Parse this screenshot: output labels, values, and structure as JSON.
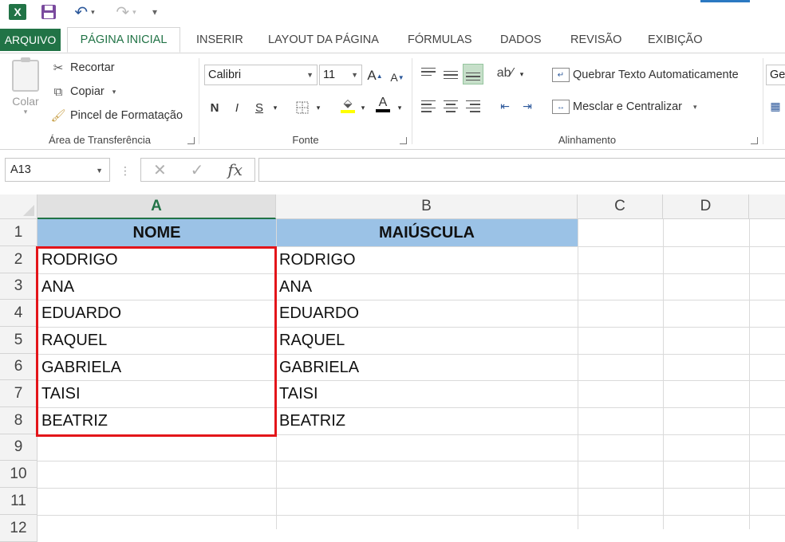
{
  "app": {
    "logo_text": "X"
  },
  "tabs": [
    "ARQUIVO",
    "PÁGINA INICIAL",
    "INSERIR",
    "LAYOUT DA PÁGINA",
    "FÓRMULAS",
    "DADOS",
    "REVISÃO",
    "EXIBIÇÃO"
  ],
  "active_tab": "PÁGINA INICIAL",
  "clipboard": {
    "paste_label": "Colar",
    "cut_label": "Recortar",
    "copy_label": "Copiar",
    "format_painter_label": "Pincel de Formatação",
    "group_label": "Área de Transferência"
  },
  "font": {
    "font_name": "Calibri",
    "font_size": "11",
    "bold": "N",
    "italic": "I",
    "underline": "S",
    "group_label": "Fonte"
  },
  "alignment": {
    "wrap_text_label": "Quebrar Texto Automaticamente",
    "merge_center_label": "Mesclar e Centralizar",
    "group_label": "Alinhamento"
  },
  "number": {
    "format_partial": "Ge"
  },
  "formula_bar": {
    "name_box": "A13",
    "fx_label": "fx",
    "formula": ""
  },
  "sheet": {
    "columns": [
      "A",
      "B",
      "C",
      "D"
    ],
    "rows": [
      "1",
      "2",
      "3",
      "4",
      "5",
      "6",
      "7",
      "8",
      "9",
      "10",
      "11",
      "12"
    ],
    "header": {
      "a": "NOME",
      "b": "MAIÚSCULA"
    },
    "names": [
      "RODRIGO",
      "ANA",
      "EDUARDO",
      "RAQUEL",
      "GABRIELA",
      "TAISI",
      "BEATRIZ"
    ],
    "upper": [
      "RODRIGO",
      "ANA",
      "EDUARDO",
      "RAQUEL",
      "GABRIELA",
      "TAISI",
      "BEATRIZ"
    ]
  },
  "colors": {
    "excel_green": "#217346",
    "header_fill": "#9bc2e6",
    "highlight_box": "#e3151a"
  }
}
